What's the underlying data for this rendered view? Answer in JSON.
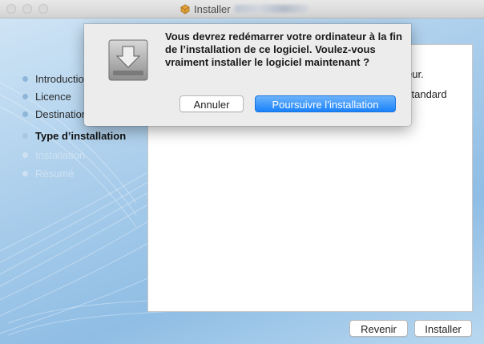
{
  "window": {
    "title": "Installer"
  },
  "sidebar": {
    "steps": [
      {
        "label": "Introduction",
        "state": "done"
      },
      {
        "label": "Licence",
        "state": "done"
      },
      {
        "label": "Destination",
        "state": "done"
      },
      {
        "label": "Type d’installation",
        "state": "active"
      },
      {
        "label": "Installation",
        "state": "pending"
      },
      {
        "label": "Résumé",
        "state": "pending"
      }
    ]
  },
  "content": {
    "fragment_1": "eur.",
    "fragment_2": "standard"
  },
  "dialog": {
    "icon": "installer-disk-icon",
    "message": "Vous devrez redémarrer votre ordinateur à la fin de l’installation de ce logiciel. Voulez-vous vraiment installer le logiciel maintenant ?",
    "cancel_label": "Annuler",
    "continue_label": "Poursuivre l’installation"
  },
  "footer": {
    "back_label": "Revenir",
    "install_label": "Installer"
  },
  "colors": {
    "accent": "#1a82fb",
    "sidebar_blue": "#a9cdeb"
  }
}
